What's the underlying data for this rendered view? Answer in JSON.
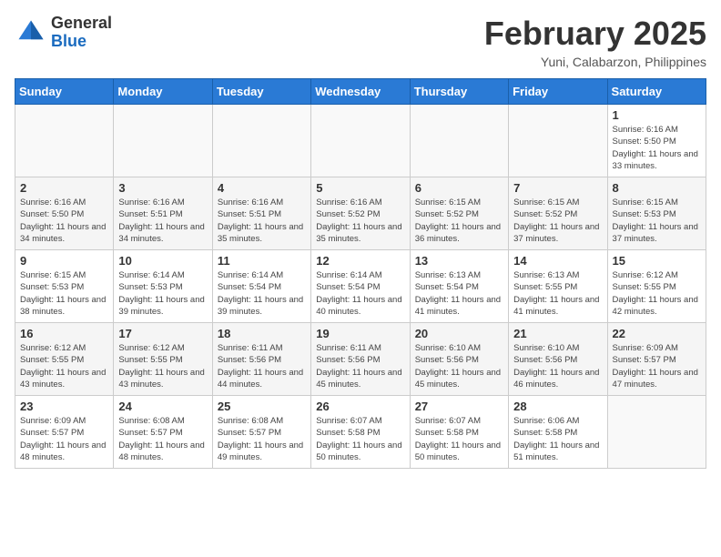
{
  "header": {
    "logo_general": "General",
    "logo_blue": "Blue",
    "month_title": "February 2025",
    "location": "Yuni, Calabarzon, Philippines"
  },
  "days_of_week": [
    "Sunday",
    "Monday",
    "Tuesday",
    "Wednesday",
    "Thursday",
    "Friday",
    "Saturday"
  ],
  "weeks": [
    [
      {
        "day": "",
        "sunrise": "",
        "sunset": "",
        "daylight": "",
        "empty": true
      },
      {
        "day": "",
        "sunrise": "",
        "sunset": "",
        "daylight": "",
        "empty": true
      },
      {
        "day": "",
        "sunrise": "",
        "sunset": "",
        "daylight": "",
        "empty": true
      },
      {
        "day": "",
        "sunrise": "",
        "sunset": "",
        "daylight": "",
        "empty": true
      },
      {
        "day": "",
        "sunrise": "",
        "sunset": "",
        "daylight": "",
        "empty": true
      },
      {
        "day": "",
        "sunrise": "",
        "sunset": "",
        "daylight": "",
        "empty": true
      },
      {
        "day": "1",
        "sunrise": "Sunrise: 6:16 AM",
        "sunset": "Sunset: 5:50 PM",
        "daylight": "Daylight: 11 hours and 33 minutes.",
        "empty": false
      }
    ],
    [
      {
        "day": "2",
        "sunrise": "Sunrise: 6:16 AM",
        "sunset": "Sunset: 5:50 PM",
        "daylight": "Daylight: 11 hours and 34 minutes.",
        "empty": false
      },
      {
        "day": "3",
        "sunrise": "Sunrise: 6:16 AM",
        "sunset": "Sunset: 5:51 PM",
        "daylight": "Daylight: 11 hours and 34 minutes.",
        "empty": false
      },
      {
        "day": "4",
        "sunrise": "Sunrise: 6:16 AM",
        "sunset": "Sunset: 5:51 PM",
        "daylight": "Daylight: 11 hours and 35 minutes.",
        "empty": false
      },
      {
        "day": "5",
        "sunrise": "Sunrise: 6:16 AM",
        "sunset": "Sunset: 5:52 PM",
        "daylight": "Daylight: 11 hours and 35 minutes.",
        "empty": false
      },
      {
        "day": "6",
        "sunrise": "Sunrise: 6:15 AM",
        "sunset": "Sunset: 5:52 PM",
        "daylight": "Daylight: 11 hours and 36 minutes.",
        "empty": false
      },
      {
        "day": "7",
        "sunrise": "Sunrise: 6:15 AM",
        "sunset": "Sunset: 5:52 PM",
        "daylight": "Daylight: 11 hours and 37 minutes.",
        "empty": false
      },
      {
        "day": "8",
        "sunrise": "Sunrise: 6:15 AM",
        "sunset": "Sunset: 5:53 PM",
        "daylight": "Daylight: 11 hours and 37 minutes.",
        "empty": false
      }
    ],
    [
      {
        "day": "9",
        "sunrise": "Sunrise: 6:15 AM",
        "sunset": "Sunset: 5:53 PM",
        "daylight": "Daylight: 11 hours and 38 minutes.",
        "empty": false
      },
      {
        "day": "10",
        "sunrise": "Sunrise: 6:14 AM",
        "sunset": "Sunset: 5:53 PM",
        "daylight": "Daylight: 11 hours and 39 minutes.",
        "empty": false
      },
      {
        "day": "11",
        "sunrise": "Sunrise: 6:14 AM",
        "sunset": "Sunset: 5:54 PM",
        "daylight": "Daylight: 11 hours and 39 minutes.",
        "empty": false
      },
      {
        "day": "12",
        "sunrise": "Sunrise: 6:14 AM",
        "sunset": "Sunset: 5:54 PM",
        "daylight": "Daylight: 11 hours and 40 minutes.",
        "empty": false
      },
      {
        "day": "13",
        "sunrise": "Sunrise: 6:13 AM",
        "sunset": "Sunset: 5:54 PM",
        "daylight": "Daylight: 11 hours and 41 minutes.",
        "empty": false
      },
      {
        "day": "14",
        "sunrise": "Sunrise: 6:13 AM",
        "sunset": "Sunset: 5:55 PM",
        "daylight": "Daylight: 11 hours and 41 minutes.",
        "empty": false
      },
      {
        "day": "15",
        "sunrise": "Sunrise: 6:12 AM",
        "sunset": "Sunset: 5:55 PM",
        "daylight": "Daylight: 11 hours and 42 minutes.",
        "empty": false
      }
    ],
    [
      {
        "day": "16",
        "sunrise": "Sunrise: 6:12 AM",
        "sunset": "Sunset: 5:55 PM",
        "daylight": "Daylight: 11 hours and 43 minutes.",
        "empty": false
      },
      {
        "day": "17",
        "sunrise": "Sunrise: 6:12 AM",
        "sunset": "Sunset: 5:55 PM",
        "daylight": "Daylight: 11 hours and 43 minutes.",
        "empty": false
      },
      {
        "day": "18",
        "sunrise": "Sunrise: 6:11 AM",
        "sunset": "Sunset: 5:56 PM",
        "daylight": "Daylight: 11 hours and 44 minutes.",
        "empty": false
      },
      {
        "day": "19",
        "sunrise": "Sunrise: 6:11 AM",
        "sunset": "Sunset: 5:56 PM",
        "daylight": "Daylight: 11 hours and 45 minutes.",
        "empty": false
      },
      {
        "day": "20",
        "sunrise": "Sunrise: 6:10 AM",
        "sunset": "Sunset: 5:56 PM",
        "daylight": "Daylight: 11 hours and 45 minutes.",
        "empty": false
      },
      {
        "day": "21",
        "sunrise": "Sunrise: 6:10 AM",
        "sunset": "Sunset: 5:56 PM",
        "daylight": "Daylight: 11 hours and 46 minutes.",
        "empty": false
      },
      {
        "day": "22",
        "sunrise": "Sunrise: 6:09 AM",
        "sunset": "Sunset: 5:57 PM",
        "daylight": "Daylight: 11 hours and 47 minutes.",
        "empty": false
      }
    ],
    [
      {
        "day": "23",
        "sunrise": "Sunrise: 6:09 AM",
        "sunset": "Sunset: 5:57 PM",
        "daylight": "Daylight: 11 hours and 48 minutes.",
        "empty": false
      },
      {
        "day": "24",
        "sunrise": "Sunrise: 6:08 AM",
        "sunset": "Sunset: 5:57 PM",
        "daylight": "Daylight: 11 hours and 48 minutes.",
        "empty": false
      },
      {
        "day": "25",
        "sunrise": "Sunrise: 6:08 AM",
        "sunset": "Sunset: 5:57 PM",
        "daylight": "Daylight: 11 hours and 49 minutes.",
        "empty": false
      },
      {
        "day": "26",
        "sunrise": "Sunrise: 6:07 AM",
        "sunset": "Sunset: 5:58 PM",
        "daylight": "Daylight: 11 hours and 50 minutes.",
        "empty": false
      },
      {
        "day": "27",
        "sunrise": "Sunrise: 6:07 AM",
        "sunset": "Sunset: 5:58 PM",
        "daylight": "Daylight: 11 hours and 50 minutes.",
        "empty": false
      },
      {
        "day": "28",
        "sunrise": "Sunrise: 6:06 AM",
        "sunset": "Sunset: 5:58 PM",
        "daylight": "Daylight: 11 hours and 51 minutes.",
        "empty": false
      },
      {
        "day": "",
        "sunrise": "",
        "sunset": "",
        "daylight": "",
        "empty": true
      }
    ]
  ]
}
